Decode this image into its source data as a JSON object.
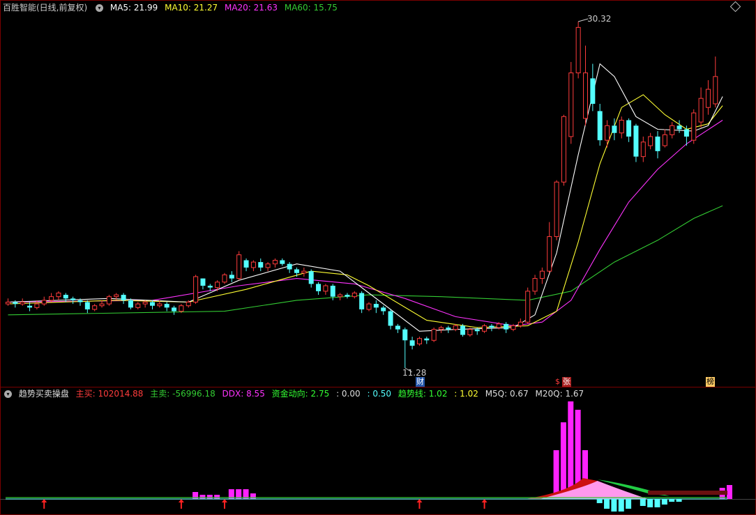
{
  "title_bar": {
    "name": "百胜智能(日线,前复权)",
    "ma5_label": "MA5: 21.99",
    "ma10_label": "MA10: 21.27",
    "ma20_label": "MA20: 21.63",
    "ma60_label": "MA60: 15.75"
  },
  "indicator_bar": {
    "name": "趋势买卖操盘",
    "main_buy": "主买: 102014.88",
    "main_sell": "主卖: -56996.18",
    "ddx": "DDX: 8.55",
    "fund_flow": "资金动向: 2.75",
    "v1": ": 0.00",
    "v2": ": 0.50",
    "trend_line": "趋势线: 1.02",
    "v3": ": 1.02",
    "m5q": "M5Q: 0.67",
    "m20q": "M20Q: 1.67"
  },
  "markers": {
    "high_label": "30.32",
    "low_label": "11.28",
    "tag_cai": "财",
    "tag_dollar": "$",
    "tag_zhang": "张",
    "tag_bang": "榜"
  },
  "colors": {
    "up": "#ff3c3c",
    "down": "#54ffff",
    "ma5": "#ffffff",
    "ma10": "#ffff33",
    "ma20": "#ff33ff",
    "ma60": "#33cc33",
    "title_blue": "#cccccc"
  },
  "chart_data": {
    "type": "candlestick",
    "price_range": [
      11.28,
      30.32
    ],
    "candles": [
      [
        14.8,
        14.9,
        14.7,
        15.1
      ],
      [
        14.9,
        14.8,
        14.6,
        15.0
      ],
      [
        14.8,
        14.9,
        14.7,
        15.1
      ],
      [
        14.7,
        14.6,
        14.4,
        14.9
      ],
      [
        14.6,
        14.8,
        14.5,
        15.0
      ],
      [
        14.8,
        15.0,
        14.7,
        15.2
      ],
      [
        15.0,
        15.2,
        14.9,
        15.4
      ],
      [
        15.2,
        15.4,
        15.0,
        15.5
      ],
      [
        15.3,
        15.1,
        14.9,
        15.4
      ],
      [
        15.1,
        15.0,
        14.8,
        15.2
      ],
      [
        15.0,
        14.9,
        14.7,
        15.1
      ],
      [
        14.9,
        14.5,
        14.3,
        15.0
      ],
      [
        14.5,
        14.7,
        14.4,
        14.8
      ],
      [
        14.7,
        14.8,
        14.6,
        15.0
      ],
      [
        14.8,
        15.2,
        14.7,
        15.3
      ],
      [
        15.2,
        15.3,
        15.0,
        15.4
      ],
      [
        15.3,
        15.0,
        14.8,
        15.4
      ],
      [
        15.0,
        14.6,
        14.5,
        15.1
      ],
      [
        14.6,
        14.8,
        14.5,
        14.9
      ],
      [
        14.8,
        14.9,
        14.6,
        15.0
      ],
      [
        14.9,
        14.7,
        14.5,
        15.0
      ],
      [
        14.7,
        14.8,
        14.6,
        15.0
      ],
      [
        14.8,
        14.6,
        14.4,
        14.9
      ],
      [
        14.6,
        14.4,
        14.2,
        14.7
      ],
      [
        14.4,
        14.7,
        14.3,
        14.8
      ],
      [
        14.7,
        14.9,
        14.6,
        15.0
      ],
      [
        14.9,
        16.3,
        14.8,
        16.4
      ],
      [
        16.2,
        15.8,
        15.6,
        16.2
      ],
      [
        15.8,
        15.7,
        15.5,
        15.9
      ],
      [
        15.7,
        16.0,
        15.5,
        16.1
      ],
      [
        16.0,
        16.4,
        15.9,
        16.5
      ],
      [
        16.4,
        16.2,
        16.0,
        16.6
      ],
      [
        16.2,
        17.5,
        16.1,
        17.7
      ],
      [
        17.2,
        16.8,
        16.6,
        17.3
      ],
      [
        16.8,
        17.1,
        16.6,
        17.2
      ],
      [
        17.1,
        16.8,
        16.6,
        17.3
      ],
      [
        16.8,
        17.0,
        16.6,
        17.1
      ],
      [
        17.0,
        17.2,
        16.8,
        17.3
      ],
      [
        17.2,
        17.0,
        16.9,
        17.3
      ],
      [
        17.0,
        16.7,
        16.5,
        17.1
      ],
      [
        16.7,
        16.5,
        16.3,
        16.8
      ],
      [
        16.5,
        16.6,
        16.3,
        16.8
      ],
      [
        16.6,
        15.9,
        15.7,
        16.7
      ],
      [
        15.9,
        15.5,
        15.3,
        16.0
      ],
      [
        15.5,
        15.8,
        15.3,
        15.9
      ],
      [
        15.8,
        15.2,
        15.0,
        15.9
      ],
      [
        15.2,
        15.3,
        15.0,
        15.4
      ],
      [
        15.3,
        15.2,
        15.1,
        15.4
      ],
      [
        15.2,
        15.4,
        15.1,
        15.5
      ],
      [
        15.4,
        14.5,
        14.3,
        15.5
      ],
      [
        14.5,
        14.8,
        14.4,
        14.9
      ],
      [
        14.8,
        14.6,
        14.3,
        15.0
      ],
      [
        14.6,
        14.4,
        14.2,
        14.7
      ],
      [
        14.4,
        13.6,
        13.4,
        14.5
      ],
      [
        13.6,
        13.4,
        13.2,
        13.7
      ],
      [
        13.4,
        12.8,
        11.28,
        13.5
      ],
      [
        12.8,
        12.5,
        12.3,
        13.0
      ],
      [
        12.6,
        12.9,
        12.5,
        13.0
      ],
      [
        12.9,
        12.8,
        12.6,
        13.0
      ],
      [
        12.8,
        13.4,
        12.7,
        13.5
      ],
      [
        13.4,
        13.5,
        13.2,
        13.6
      ],
      [
        13.5,
        13.4,
        13.2,
        13.6
      ],
      [
        13.4,
        13.6,
        13.3,
        13.7
      ],
      [
        13.6,
        13.1,
        13.0,
        13.7
      ],
      [
        13.1,
        13.4,
        13.0,
        13.5
      ],
      [
        13.4,
        13.3,
        13.1,
        13.5
      ],
      [
        13.3,
        13.6,
        13.2,
        13.7
      ],
      [
        13.6,
        13.5,
        13.3,
        13.7
      ],
      [
        13.5,
        13.7,
        13.4,
        13.8
      ],
      [
        13.7,
        13.4,
        13.2,
        13.8
      ],
      [
        13.4,
        13.6,
        13.3,
        13.7
      ],
      [
        13.6,
        13.8,
        13.5,
        14.0
      ],
      [
        13.8,
        15.5,
        13.7,
        15.7
      ],
      [
        15.5,
        16.2,
        15.3,
        16.4
      ],
      [
        16.2,
        16.6,
        15.9,
        16.8
      ],
      [
        16.6,
        18.5,
        16.5,
        19.3
      ],
      [
        18.5,
        21.5,
        18.3,
        21.6
      ],
      [
        21.5,
        25.1,
        21.3,
        25.2
      ],
      [
        24.0,
        27.5,
        23.6,
        28.1
      ],
      [
        27.5,
        30.0,
        27.2,
        30.32
      ],
      [
        25.0,
        27.5,
        24.6,
        29.0
      ],
      [
        27.2,
        25.8,
        25.4,
        28.0
      ],
      [
        25.4,
        23.8,
        23.5,
        25.8
      ],
      [
        23.8,
        24.6,
        23.4,
        24.9
      ],
      [
        24.6,
        24.2,
        23.8,
        25.0
      ],
      [
        24.2,
        24.9,
        23.9,
        25.1
      ],
      [
        24.9,
        24.0,
        23.7,
        25.0
      ],
      [
        24.6,
        22.9,
        22.6,
        24.7
      ],
      [
        22.9,
        23.7,
        22.6,
        24.0
      ],
      [
        23.5,
        24.0,
        23.3,
        24.2
      ],
      [
        24.0,
        23.2,
        22.8,
        24.3
      ],
      [
        23.5,
        24.1,
        23.4,
        24.4
      ],
      [
        24.1,
        24.6,
        23.9,
        24.8
      ],
      [
        24.6,
        24.4,
        24.2,
        24.9
      ],
      [
        24.4,
        24.0,
        23.5,
        24.6
      ],
      [
        23.8,
        25.3,
        23.6,
        25.5
      ],
      [
        24.8,
        26.1,
        24.5,
        26.7
      ],
      [
        25.6,
        26.6,
        25.2,
        27.1
      ],
      [
        25.8,
        27.3,
        25.6,
        28.4
      ]
    ],
    "ma5_points": [
      [
        14.9,
        0
      ],
      [
        15.1,
        14
      ],
      [
        14.9,
        25
      ],
      [
        16.1,
        32
      ],
      [
        17.0,
        40
      ],
      [
        16.6,
        46
      ],
      [
        15.4,
        50
      ],
      [
        13.3,
        57
      ],
      [
        13.4,
        62
      ],
      [
        13.5,
        70
      ],
      [
        14.2,
        73
      ],
      [
        17.6,
        76
      ],
      [
        23.0,
        79
      ],
      [
        28.0,
        82
      ],
      [
        27.3,
        84
      ],
      [
        25.1,
        87
      ],
      [
        24.4,
        90
      ],
      [
        24.3,
        95
      ],
      [
        24.6,
        97
      ],
      [
        26.2,
        99
      ]
    ],
    "ma10_points": [
      [
        14.8,
        0
      ],
      [
        15.0,
        15
      ],
      [
        14.9,
        25
      ],
      [
        15.6,
        33
      ],
      [
        16.6,
        42
      ],
      [
        16.4,
        47
      ],
      [
        15.8,
        50
      ],
      [
        13.9,
        58
      ],
      [
        13.5,
        65
      ],
      [
        13.6,
        72
      ],
      [
        14.4,
        76
      ],
      [
        18.2,
        79
      ],
      [
        22.5,
        82
      ],
      [
        25.6,
        85
      ],
      [
        26.3,
        88
      ],
      [
        25.2,
        91
      ],
      [
        24.4,
        94
      ],
      [
        24.7,
        97
      ],
      [
        25.7,
        99
      ]
    ],
    "ma20_points": [
      [
        14.9,
        0
      ],
      [
        15.0,
        20
      ],
      [
        15.8,
        32
      ],
      [
        16.2,
        40
      ],
      [
        15.9,
        48
      ],
      [
        15.1,
        55
      ],
      [
        14.1,
        62
      ],
      [
        13.6,
        70
      ],
      [
        13.8,
        74
      ],
      [
        15.0,
        78
      ],
      [
        17.8,
        82
      ],
      [
        20.4,
        86
      ],
      [
        22.2,
        90
      ],
      [
        23.6,
        94
      ],
      [
        24.9,
        99
      ]
    ],
    "ma60_points": [
      [
        14.2,
        0
      ],
      [
        14.4,
        30
      ],
      [
        15.0,
        40
      ],
      [
        15.3,
        50
      ],
      [
        15.2,
        60
      ],
      [
        15.0,
        72
      ],
      [
        15.5,
        78
      ],
      [
        17.1,
        84
      ],
      [
        18.3,
        90
      ],
      [
        19.5,
        95
      ],
      [
        20.2,
        99
      ]
    ]
  }
}
